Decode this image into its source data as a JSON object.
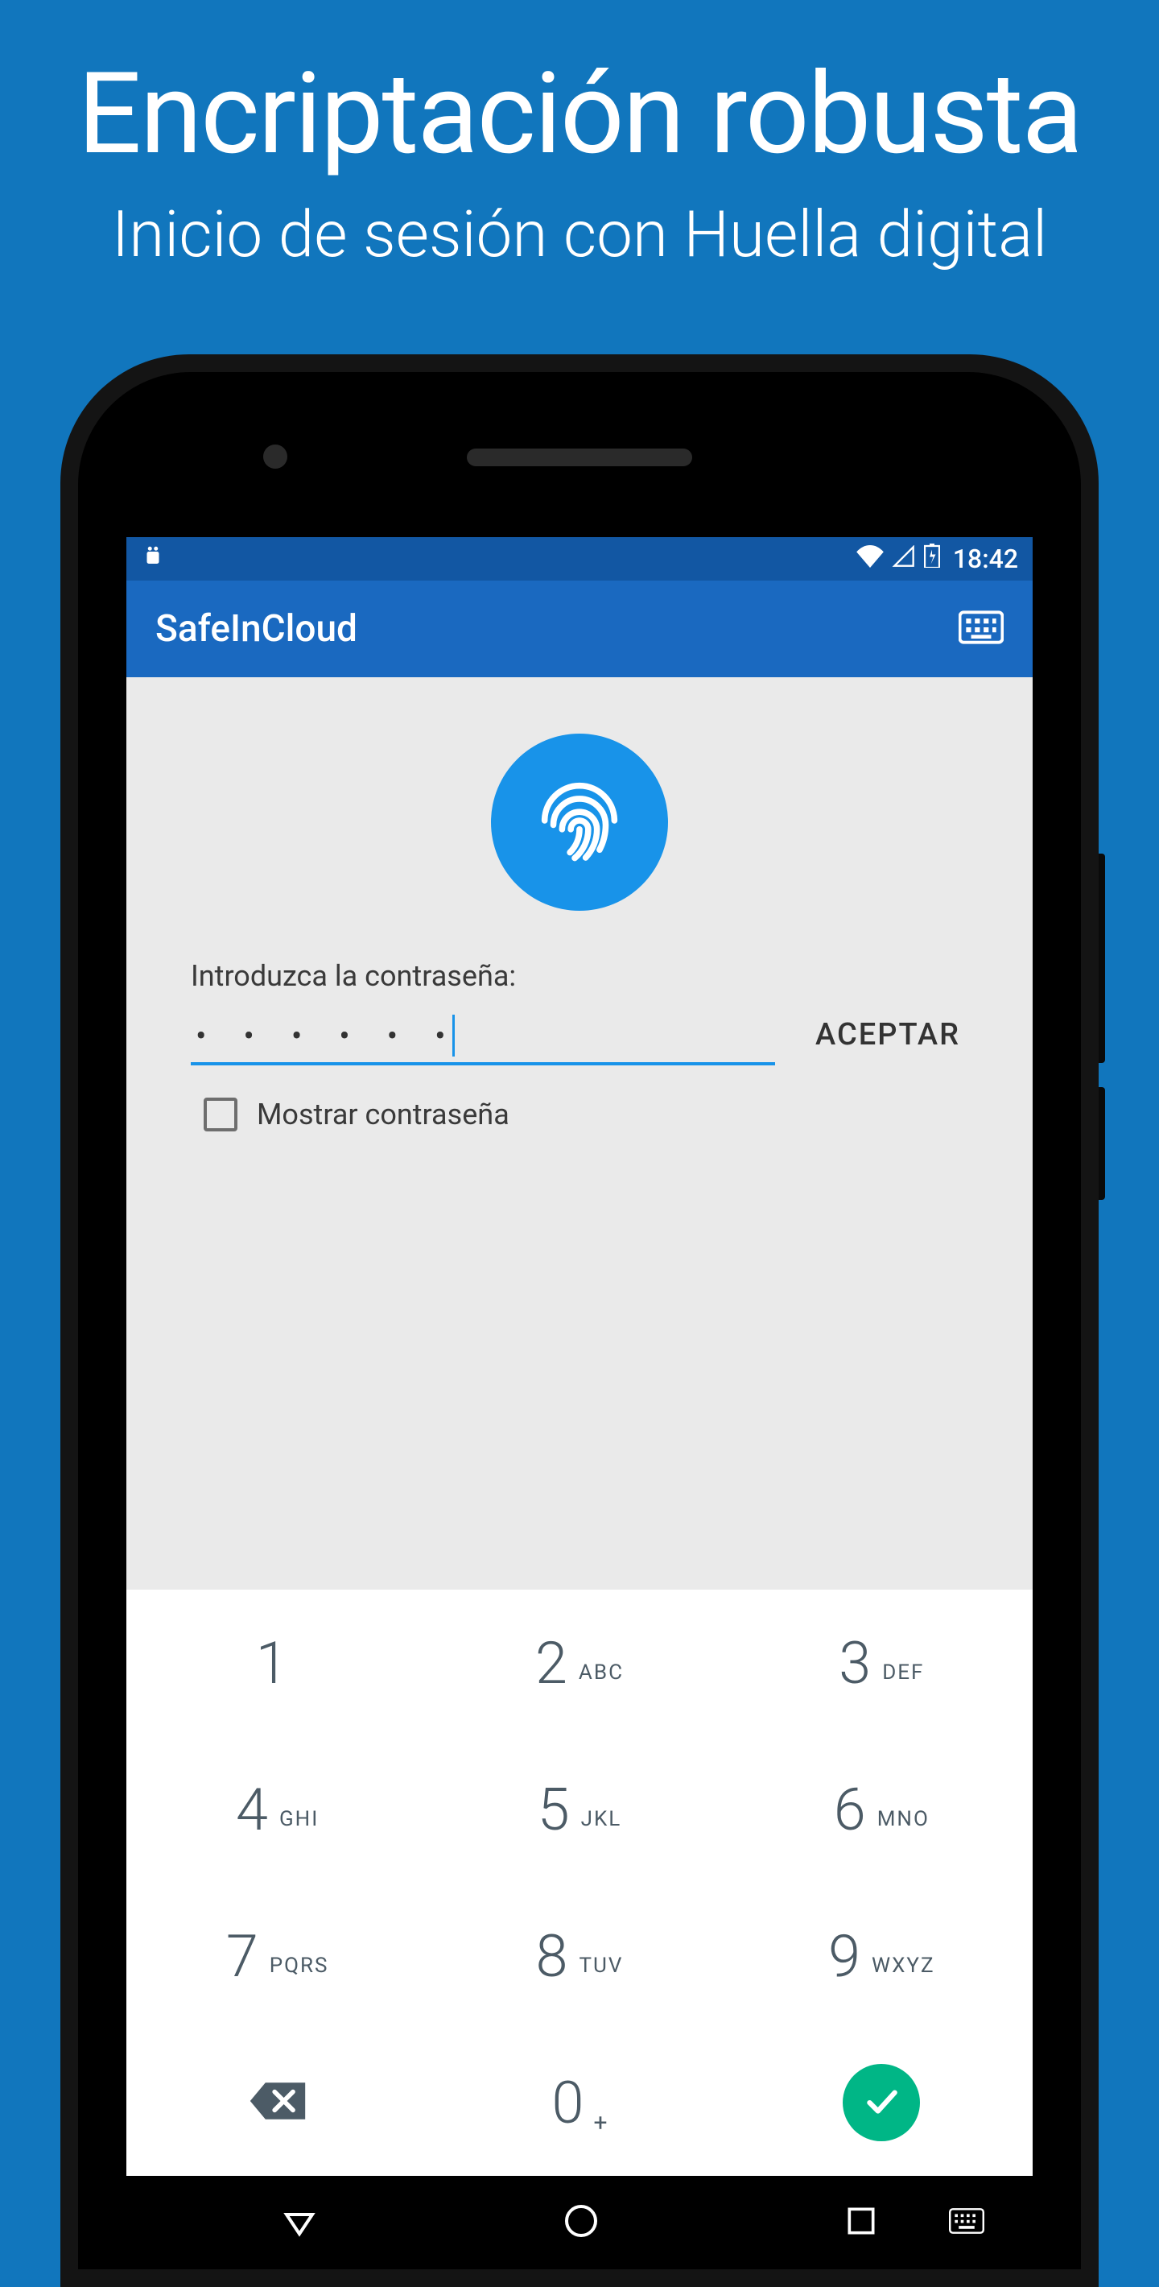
{
  "promo": {
    "title": "Encriptación robusta",
    "subtitle": "Inicio de sesión con Huella digital"
  },
  "statusbar": {
    "time": "18:42"
  },
  "appbar": {
    "title": "SafeInCloud"
  },
  "login": {
    "password_label": "Introduzca la contraseña:",
    "password_mask": "• • • • • •",
    "accept_button": "ACEPTAR",
    "show_password_label": "Mostrar contraseña",
    "show_password_checked": false
  },
  "keypad": {
    "keys": [
      {
        "digit": "1",
        "letters": ""
      },
      {
        "digit": "2",
        "letters": "ABC"
      },
      {
        "digit": "3",
        "letters": "DEF"
      },
      {
        "digit": "4",
        "letters": "GHI"
      },
      {
        "digit": "5",
        "letters": "JKL"
      },
      {
        "digit": "6",
        "letters": "MNO"
      },
      {
        "digit": "7",
        "letters": "PQRS"
      },
      {
        "digit": "8",
        "letters": "TUV"
      },
      {
        "digit": "9",
        "letters": "WXYZ"
      }
    ],
    "zero": {
      "digit": "0",
      "sub": "+"
    }
  }
}
